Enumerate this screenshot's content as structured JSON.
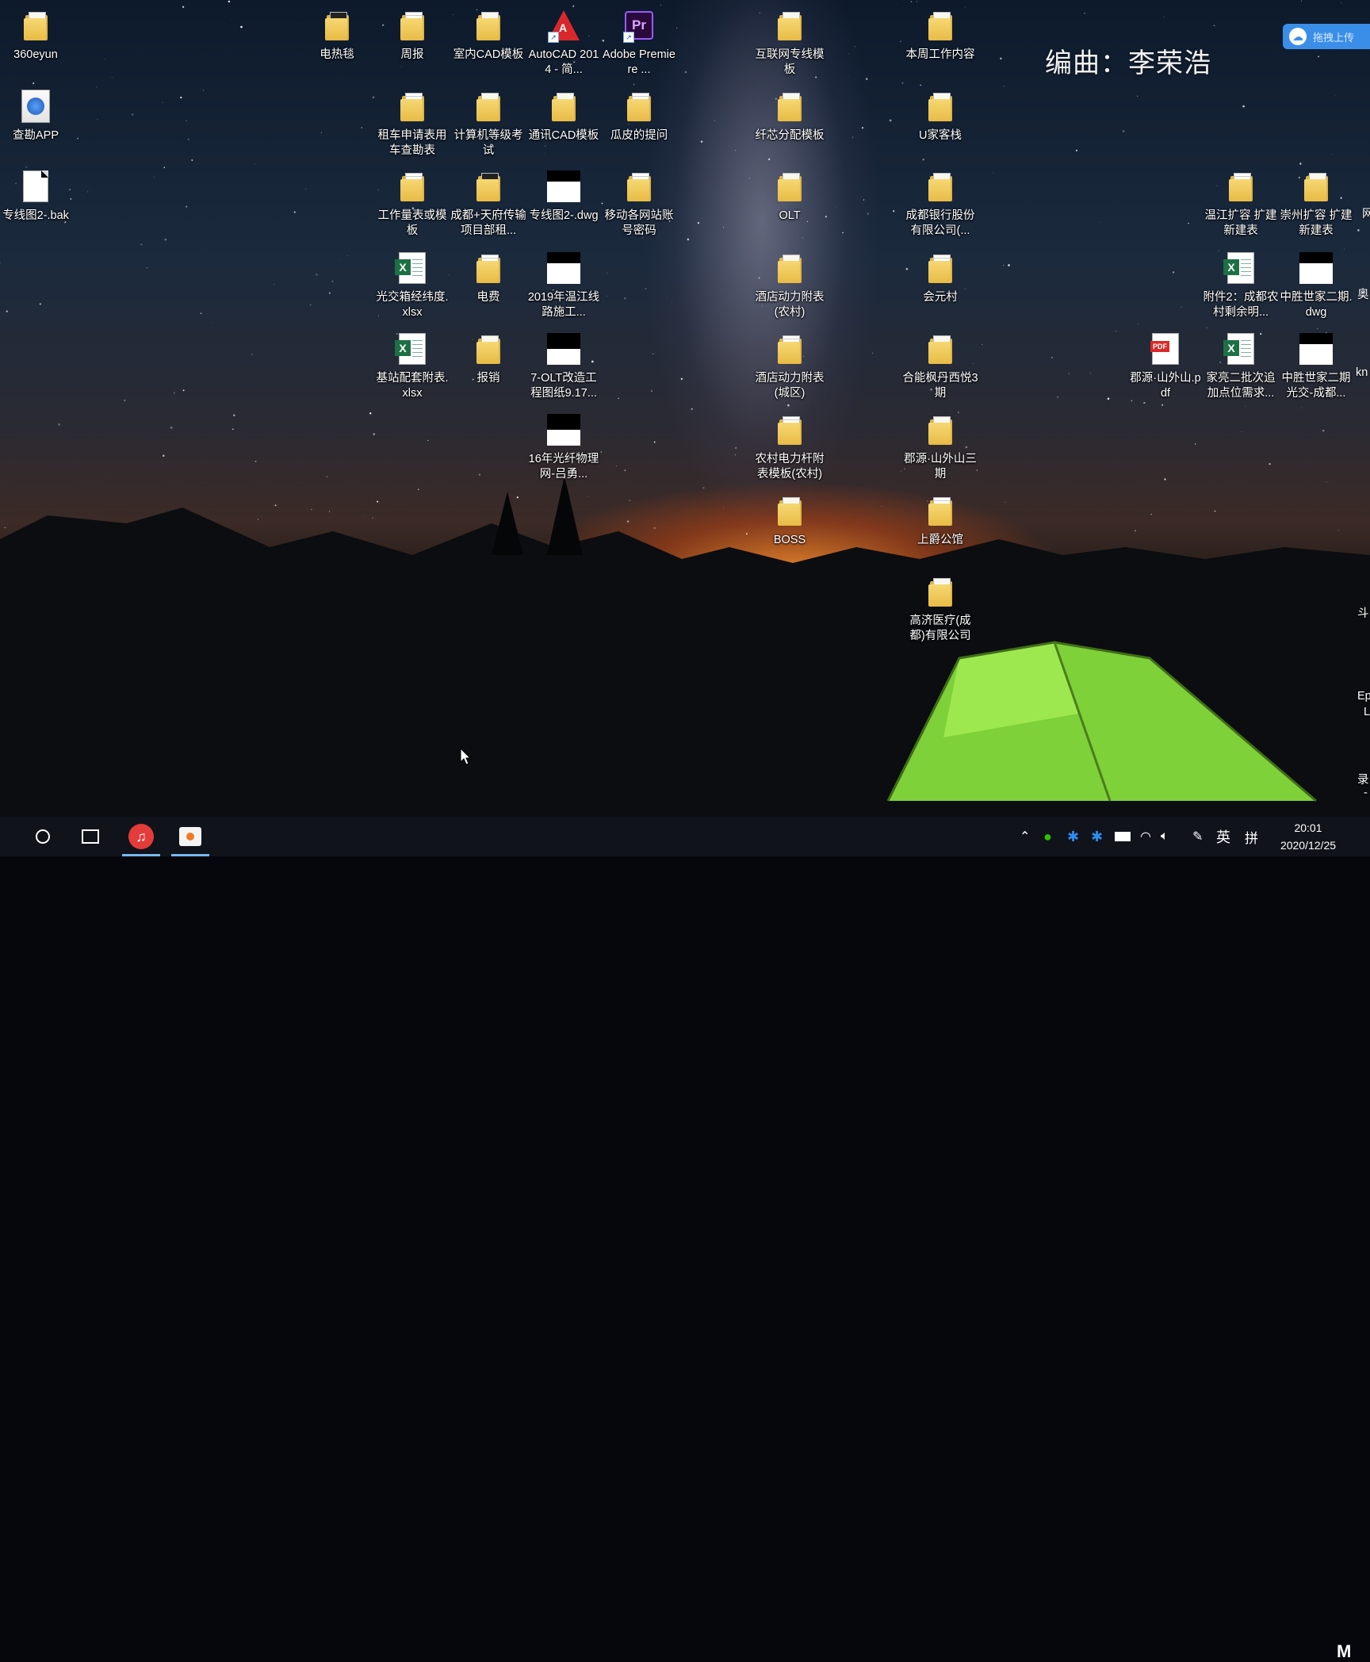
{
  "wallpaper": {
    "theme": "night-sky-milky-way-mountains-tent",
    "accent": "#8fe03a"
  },
  "watermark": "编曲：李荣浩",
  "upload_widget": {
    "label": "拖拽上传"
  },
  "icons": [
    {
      "name": "360eyun",
      "icon": "folder-icon",
      "type": "folder"
    },
    {
      "name": "查勘APP",
      "icon": "baidu-app-icon",
      "type": "app"
    },
    {
      "name": "专线图2-.bak",
      "icon": "blank-file-icon",
      "type": "file"
    },
    {
      "name": "电热毯",
      "icon": "folder-icon",
      "type": "folder"
    },
    {
      "name": "周报",
      "icon": "folder-icon",
      "type": "folder"
    },
    {
      "name": "室内CAD模板",
      "icon": "folder-icon",
      "type": "folder"
    },
    {
      "name": "AutoCAD 2014 - 简...",
      "icon": "autocad-icon",
      "type": "app"
    },
    {
      "name": "Adobe Premiere ...",
      "icon": "premiere-icon",
      "type": "app"
    },
    {
      "name": "互联网专线模板",
      "icon": "folder-icon",
      "type": "folder"
    },
    {
      "name": "本周工作内容",
      "icon": "folder-icon",
      "type": "folder"
    },
    {
      "name": "租车申请表用车查勘表",
      "icon": "folder-icon",
      "type": "folder"
    },
    {
      "name": "计算机等级考试",
      "icon": "folder-icon",
      "type": "folder"
    },
    {
      "name": "通讯CAD模板",
      "icon": "folder-icon",
      "type": "folder"
    },
    {
      "name": "瓜皮的提问",
      "icon": "folder-icon",
      "type": "folder"
    },
    {
      "name": "纤芯分配模板",
      "icon": "folder-icon",
      "type": "folder"
    },
    {
      "name": "U家客栈",
      "icon": "folder-icon",
      "type": "folder"
    },
    {
      "name": "工作量表或模板",
      "icon": "folder-icon",
      "type": "folder"
    },
    {
      "name": "成都+天府传输项目部租...",
      "icon": "folder-icon",
      "type": "folder"
    },
    {
      "name": "专线图2-.dwg",
      "icon": "dwg-icon",
      "type": "file"
    },
    {
      "name": "移动各网站账号密码",
      "icon": "folder-icon",
      "type": "folder"
    },
    {
      "name": "OLT",
      "icon": "folder-icon",
      "type": "folder"
    },
    {
      "name": "成都银行股份有限公司(...",
      "icon": "folder-icon",
      "type": "folder"
    },
    {
      "name": "温江扩容 扩建 新建表",
      "icon": "folder-icon",
      "type": "folder"
    },
    {
      "name": "崇州扩容 扩建 新建表",
      "icon": "folder-icon",
      "type": "folder"
    },
    {
      "name": "光交箱经纬度.xlsx",
      "icon": "excel-icon",
      "type": "file"
    },
    {
      "name": "电费",
      "icon": "folder-icon",
      "type": "folder"
    },
    {
      "name": "2019年温江线路施工...",
      "icon": "dwg-icon",
      "type": "file"
    },
    {
      "name": "酒店动力附表(农村)",
      "icon": "folder-icon",
      "type": "folder"
    },
    {
      "name": "会元村",
      "icon": "folder-icon",
      "type": "folder"
    },
    {
      "name": "附件2：成都农村剩余明...",
      "icon": "excel-icon",
      "type": "file"
    },
    {
      "name": "中胜世家二期.dwg",
      "icon": "dwg-icon",
      "type": "file"
    },
    {
      "name": "基站配套附表.xlsx",
      "icon": "excel-icon",
      "type": "file"
    },
    {
      "name": "报销",
      "icon": "folder-icon",
      "type": "folder"
    },
    {
      "name": "7-OLT改造工程图纸9.17...",
      "icon": "dwg-icon",
      "type": "file"
    },
    {
      "name": "酒店动力附表(城区)",
      "icon": "folder-icon",
      "type": "folder"
    },
    {
      "name": "合能枫丹西悦3期",
      "icon": "folder-icon",
      "type": "folder"
    },
    {
      "name": "郡源·山外山.pdf",
      "icon": "pdf-icon",
      "type": "file"
    },
    {
      "name": "家亮二批次追加点位需求...",
      "icon": "excel-icon",
      "type": "file"
    },
    {
      "name": "中胜世家二期光交-成都...",
      "icon": "dwg-icon",
      "type": "file"
    },
    {
      "name": "16年光纤物理网-吕勇...",
      "icon": "dwg-icon",
      "type": "file"
    },
    {
      "name": "农村电力杆附表模板(农村)",
      "icon": "folder-icon",
      "type": "folder"
    },
    {
      "name": "郡源·山外山三期",
      "icon": "folder-icon",
      "type": "folder"
    },
    {
      "name": "BOSS",
      "icon": "folder-icon",
      "type": "folder"
    },
    {
      "name": "上爵公馆",
      "icon": "folder-icon",
      "type": "folder"
    },
    {
      "name": "高济医疗(成都)有限公司",
      "icon": "folder-icon",
      "type": "folder"
    }
  ],
  "edge_fragments": [
    "网",
    "奥",
    "kn",
    "斗",
    "Ep",
    "L",
    "录",
    "-"
  ],
  "taskbar": {
    "pinned": [
      {
        "name": "search",
        "icon": "cortana-circle-icon"
      },
      {
        "name": "task-view",
        "icon": "task-view-icon"
      },
      {
        "name": "netease-music",
        "icon": "netease-music-icon",
        "active": true
      },
      {
        "name": "screen-recorder",
        "icon": "recorder-icon",
        "active": true
      }
    ],
    "tray": {
      "ime_lang": "英",
      "ime_mode": "拼",
      "time": "20:01",
      "date": "2020/12/25",
      "notify": "M"
    }
  }
}
